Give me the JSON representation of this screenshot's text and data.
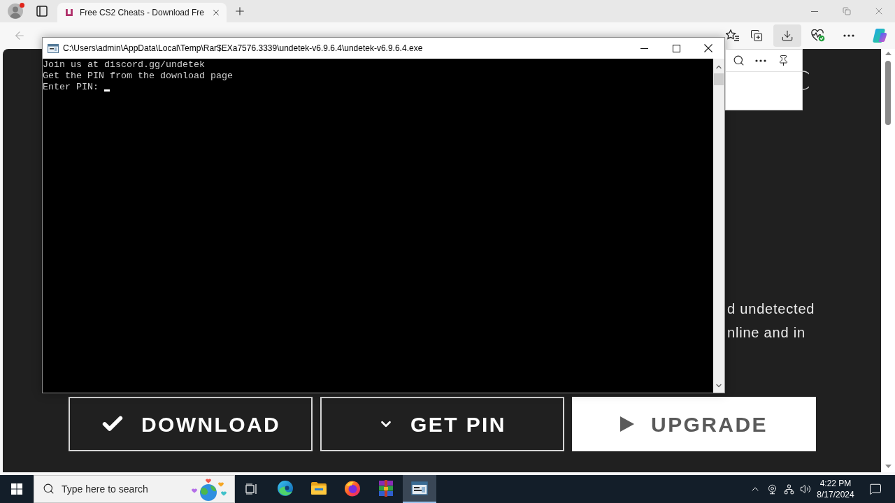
{
  "browser": {
    "tabs": [
      {
        "title": "Free CS2 Cheats - Download Fre",
        "selected": true
      }
    ],
    "downloads_open": true
  },
  "page": {
    "text_lines": [
      "d undetected",
      "nline and in"
    ],
    "buttons": [
      {
        "label": "DOWNLOAD",
        "kind": "outline"
      },
      {
        "label": "GET PIN",
        "kind": "outline"
      },
      {
        "label": "UPGRADE",
        "kind": "solid"
      }
    ]
  },
  "console": {
    "title": "C:\\Users\\admin\\AppData\\Local\\Temp\\Rar$EXa7576.3339\\undetek-v6.9.6.4\\undetek-v6.9.6.4.exe",
    "lines": [
      "Join us at discord.gg/undetek",
      "Get the PIN from the download page"
    ],
    "prompt": "Enter PIN:"
  },
  "taskbar": {
    "search": {
      "placeholder": "Type here to search"
    },
    "apps": [
      {
        "kind": "edge",
        "selected": false
      },
      {
        "kind": "folder",
        "selected": false
      },
      {
        "kind": "firefox",
        "selected": false
      },
      {
        "kind": "archive",
        "selected": false
      },
      {
        "kind": "console",
        "selected": true
      }
    ],
    "clock": {
      "time": "4:22 PM",
      "date": "8/17/2024"
    }
  }
}
